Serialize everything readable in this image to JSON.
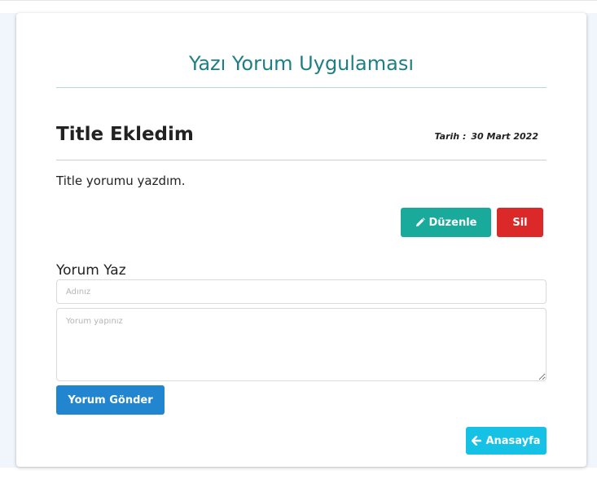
{
  "app": {
    "title": "Yazı Yorum Uygulaması"
  },
  "post": {
    "title": "Title Ekledim",
    "date_label": "Tarih :",
    "date_value": "30 Mart 2022",
    "body": "Title yorumu yazdım."
  },
  "actions": {
    "edit_label": "Düzenle",
    "edit_icon": "pencil-icon",
    "delete_label": "Sil"
  },
  "comment_form": {
    "heading": "Yorum Yaz",
    "name_placeholder": "Adınız",
    "name_value": "",
    "comment_placeholder": "Yorum yapınız",
    "comment_value": "",
    "submit_label": "Yorum Gönder"
  },
  "nav": {
    "home_label": "Anasayfa",
    "home_icon": "arrow-left-icon"
  },
  "colors": {
    "title": "#1d7f84",
    "edit_button": "#1aaa9b",
    "delete_button": "#db2828",
    "submit_button": "#2185d0",
    "home_button": "#16c1e6"
  }
}
